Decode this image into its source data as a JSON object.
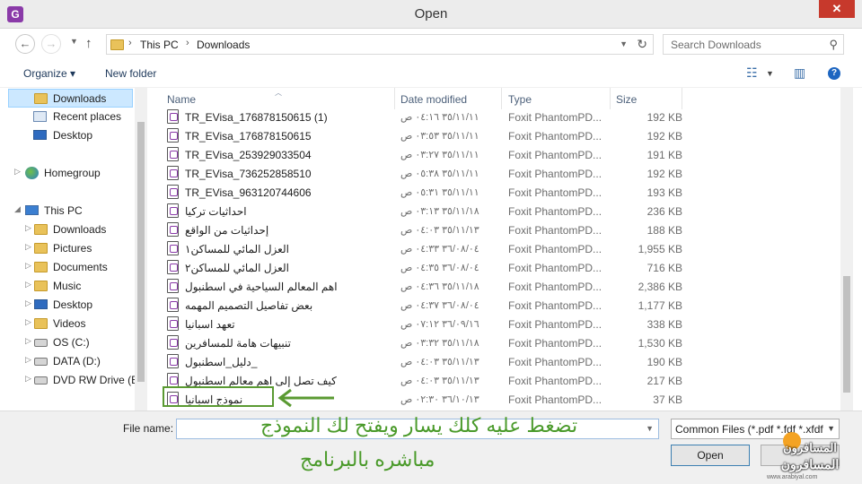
{
  "window": {
    "title": "Open",
    "close_glyph": "✕",
    "app_icon_letter": "G"
  },
  "address": {
    "crumbs": [
      "This PC",
      "Downloads"
    ],
    "search_placeholder": "Search Downloads"
  },
  "toolbar": {
    "organize": "Organize ▾",
    "new_folder": "New folder"
  },
  "sidebar": {
    "items": [
      {
        "label": "Downloads",
        "icon": "folder-icon"
      },
      {
        "label": "Recent places",
        "icon": "recent-icon"
      },
      {
        "label": "Desktop",
        "icon": "desktop-icon"
      },
      {
        "label": "Homegroup",
        "icon": "homegroup-icon"
      },
      {
        "label": "This PC",
        "icon": "computer-icon"
      },
      {
        "label": "Downloads",
        "icon": "folder-icon"
      },
      {
        "label": "Pictures",
        "icon": "folder-icon"
      },
      {
        "label": "Documents",
        "icon": "folder-icon"
      },
      {
        "label": "Music",
        "icon": "folder-icon"
      },
      {
        "label": "Desktop",
        "icon": "desktop-icon"
      },
      {
        "label": "Videos",
        "icon": "folder-icon"
      },
      {
        "label": "OS (C:)",
        "icon": "drive-icon"
      },
      {
        "label": "DATA (D:)",
        "icon": "drive-icon"
      },
      {
        "label": "DVD RW Drive (E:",
        "icon": "dvd-icon"
      }
    ]
  },
  "columns": {
    "name": "Name",
    "date": "Date modified",
    "type": "Type",
    "size": "Size"
  },
  "files": [
    {
      "name": "TR_EVisa_176878150615 (1)",
      "date": "٣٥/١١/١١ ٠٤:١٦ ص",
      "type": "Foxit PhantomPD...",
      "size": "192 KB"
    },
    {
      "name": "TR_EVisa_176878150615",
      "date": "٣٥/١١/١١ ٠٣:٥٣ ص",
      "type": "Foxit PhantomPD...",
      "size": "192 KB"
    },
    {
      "name": "TR_EVisa_253929033504",
      "date": "٣٥/١١/١١ ٠٣:٢٧ ص",
      "type": "Foxit PhantomPD...",
      "size": "191 KB"
    },
    {
      "name": "TR_EVisa_736252858510",
      "date": "٣٥/١١/١١ ٠٥:٣٨ ص",
      "type": "Foxit PhantomPD...",
      "size": "192 KB"
    },
    {
      "name": "TR_EVisa_963120744606",
      "date": "٣٥/١١/١١ ٠٥:٣١ ص",
      "type": "Foxit PhantomPD...",
      "size": "193 KB"
    },
    {
      "name": "احداثيات تركيا",
      "date": "٣٥/١١/١٨ ٠٣:١٣ ص",
      "type": "Foxit PhantomPD...",
      "size": "236 KB"
    },
    {
      "name": "إحداثيات من الواقع",
      "date": "٣٥/١١/١٣ ٠٤:٠٣ ص",
      "type": "Foxit PhantomPD...",
      "size": "188 KB"
    },
    {
      "name": "العزل المائي للمساكن١",
      "date": "٣٦/٠٨/٠٤ ٠٤:٣٣ ص",
      "type": "Foxit PhantomPD...",
      "size": "1,955 KB"
    },
    {
      "name": "العزل المائي للمساكن٢",
      "date": "٣٦/٠٨/٠٤ ٠٤:٣٥ ص",
      "type": "Foxit PhantomPD...",
      "size": "716 KB"
    },
    {
      "name": "اهم المعالم السياحية في اسطنبول",
      "date": "٣٥/١١/١٨ ٠٤:٣٦ ص",
      "type": "Foxit PhantomPD...",
      "size": "2,386 KB"
    },
    {
      "name": "بعض تفاصيل التصميم المهمه",
      "date": "٣٦/٠٨/٠٤ ٠٤:٣٧ ص",
      "type": "Foxit PhantomPD...",
      "size": "1,177 KB"
    },
    {
      "name": "تعهد اسبانيا",
      "date": "٣٦/٠٩/١٦ ٠٧:١٢ ص",
      "type": "Foxit PhantomPD...",
      "size": "338 KB"
    },
    {
      "name": "تنبيهات هامة للمسافرين",
      "date": "٣٥/١١/١٨ ٠٣:٣٢ ص",
      "type": "Foxit PhantomPD...",
      "size": "1,530 KB"
    },
    {
      "name": "دليل_اسطنبول_",
      "date": "٣٥/١١/١٣ ٠٤:٠٣ ص",
      "type": "Foxit PhantomPD...",
      "size": "190 KB"
    },
    {
      "name": "كيف تصل إلى اهم معالم اسطنبول",
      "date": "٣٥/١١/١٣ ٠٤:٠٣ ص",
      "type": "Foxit PhantomPD...",
      "size": "217 KB"
    },
    {
      "name": "نموذج اسبانيا",
      "date": "٣٦/١٠/١٣ ٠٢:٣٠ ص",
      "type": "Foxit PhantomPD...",
      "size": "37 KB"
    }
  ],
  "bottom": {
    "file_name_label": "File name:",
    "file_name_value": "",
    "filter": "Common Files (*.pdf *.fdf *.xfdf",
    "open": "Open",
    "cancel": ""
  },
  "annotation": {
    "line1": "تضغط عليه كلك يسار ويفتح  لك النموذج",
    "line2": "مباشره بالبرنامج",
    "color": "#4a9a2a"
  },
  "watermark": {
    "line1": "المسافرون",
    "line2": "المسافرون",
    "url": "www.arabiyal.com"
  }
}
